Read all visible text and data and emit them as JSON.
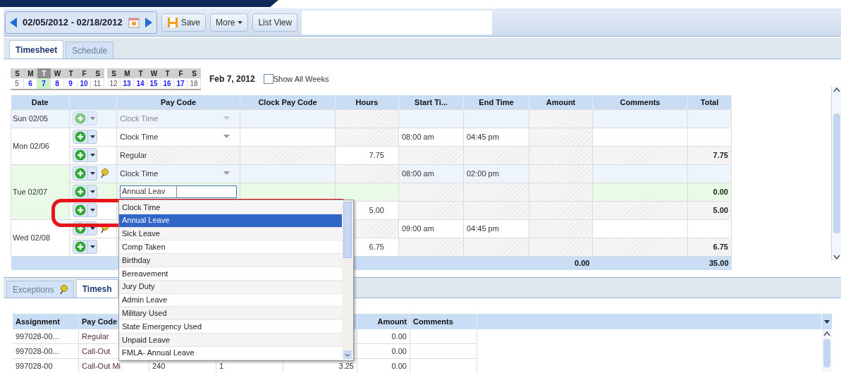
{
  "toolbar": {
    "date_range": "02/05/2012 - 02/18/2012",
    "buttons": [
      {
        "label": "Save",
        "kind": "save"
      },
      {
        "label": "More",
        "kind": "menu"
      },
      {
        "label": "List View",
        "kind": "plain"
      }
    ]
  },
  "tabs": [
    {
      "label": "Timesheet",
      "selected": true
    },
    {
      "label": "Schedule",
      "selected": false
    }
  ],
  "calendar": {
    "weeks": [
      {
        "days": [
          {
            "letter": "S",
            "date": "5",
            "kind": "weekend",
            "selected": false
          },
          {
            "letter": "M",
            "date": "6",
            "kind": "weekday",
            "selected": false
          },
          {
            "letter": "T",
            "date": "7",
            "kind": "weekday",
            "selected": true
          },
          {
            "letter": "W",
            "date": "8",
            "kind": "weekday",
            "selected": false
          },
          {
            "letter": "T",
            "date": "9",
            "kind": "weekday",
            "selected": false
          },
          {
            "letter": "F",
            "date": "10",
            "kind": "weekday",
            "selected": false
          },
          {
            "letter": "S",
            "date": "11",
            "kind": "weekend",
            "selected": false
          }
        ]
      },
      {
        "days": [
          {
            "letter": "S",
            "date": "12",
            "kind": "weekend",
            "selected": false
          },
          {
            "letter": "M",
            "date": "13",
            "kind": "weekday",
            "selected": false
          },
          {
            "letter": "T",
            "date": "14",
            "kind": "weekday",
            "selected": false
          },
          {
            "letter": "W",
            "date": "15",
            "kind": "weekday",
            "selected": false
          },
          {
            "letter": "T",
            "date": "16",
            "kind": "weekday",
            "selected": false
          },
          {
            "letter": "F",
            "date": "17",
            "kind": "weekday",
            "selected": false
          },
          {
            "letter": "S",
            "date": "18",
            "kind": "weekend",
            "selected": false
          }
        ]
      }
    ],
    "date_label": "Feb 7, 2012",
    "show_all_weeks": {
      "label": "Show All Weeks",
      "checked": false
    }
  },
  "grid": {
    "columns": [
      "Date",
      "Pay Code",
      "Clock Pay Code",
      "Hours",
      "Start Ti...",
      "End Time",
      "Amount",
      "Comments",
      "Total"
    ],
    "days": [
      {
        "date": "Sun 02/05",
        "selected": false,
        "entries": [
          {
            "kind": "clock",
            "pay_code": "Clock Time",
            "disabled": true,
            "pin": false,
            "editing": false
          }
        ]
      },
      {
        "date": "Mon 02/06",
        "selected": false,
        "entries": [
          {
            "kind": "clock",
            "pay_code": "Clock Time",
            "disabled": false,
            "pin": false,
            "editing": false,
            "start": "08:00 am",
            "end": "04:45 pm"
          },
          {
            "kind": "hours",
            "pay_code": "Regular",
            "disabled": false,
            "pin": false,
            "editing": false,
            "hours": "7.75",
            "total": "7.75"
          }
        ]
      },
      {
        "date": "Tue 02/07",
        "selected": true,
        "entries": [
          {
            "kind": "clock",
            "pay_code": "Clock Time",
            "disabled": false,
            "pin": true,
            "editing": false,
            "start": "08:00 am",
            "end": "02:00 pm"
          },
          {
            "kind": "hours",
            "pay_code": "Annual Leav",
            "disabled": false,
            "pin": false,
            "editing": true,
            "total": "0.00"
          },
          {
            "kind": "hours",
            "disabled": false,
            "pin": false,
            "editing": false,
            "hours": "5.00",
            "total": "5.00"
          }
        ]
      },
      {
        "date": "Wed 02/08",
        "selected": false,
        "entries": [
          {
            "kind": "clock",
            "disabled": false,
            "pin": true,
            "editing": false,
            "start": "09:00 am",
            "end": "04:45 pm"
          },
          {
            "kind": "hours",
            "disabled": false,
            "pin": false,
            "editing": false,
            "hours": "6.75",
            "total": "6.75"
          }
        ]
      }
    ],
    "footer": {
      "amount": "0.00",
      "total": "35.00"
    }
  },
  "dropdown": {
    "options": [
      {
        "label": "Clock Time",
        "selected": false
      },
      {
        "label": "Annual Leave",
        "selected": true
      },
      {
        "label": "Sick Leave",
        "selected": false
      },
      {
        "label": "Comp Taken",
        "selected": false
      },
      {
        "label": "Birthday",
        "selected": false
      },
      {
        "label": "Bereavement",
        "selected": false
      },
      {
        "label": "Jury Duty",
        "selected": false
      },
      {
        "label": "Admin Leave",
        "selected": false
      },
      {
        "label": "Military Used",
        "selected": false
      },
      {
        "label": "State Emergency Used",
        "selected": false
      },
      {
        "label": "Unpaid Leave",
        "selected": false
      },
      {
        "label": "FMLA- Annual Leave",
        "selected": false
      }
    ]
  },
  "bottom": {
    "tabs": [
      {
        "label": "Exceptions",
        "selected": false,
        "pin": true
      },
      {
        "label": "Timesh",
        "selected": true,
        "pin": false
      }
    ],
    "table": {
      "columns": [
        "Assignment",
        "Pay Code",
        null,
        null,
        null,
        "Amount",
        "Comments"
      ],
      "rows": [
        [
          "997028-00...",
          "Regular",
          null,
          null,
          null,
          "0.00",
          null
        ],
        [
          "997028-00...",
          "Call-Out",
          null,
          null,
          null,
          "0.00",
          null
        ],
        [
          "997028-00",
          "Call-Out Mi",
          "240",
          "1",
          "3.25",
          "0.00",
          null
        ]
      ]
    }
  }
}
